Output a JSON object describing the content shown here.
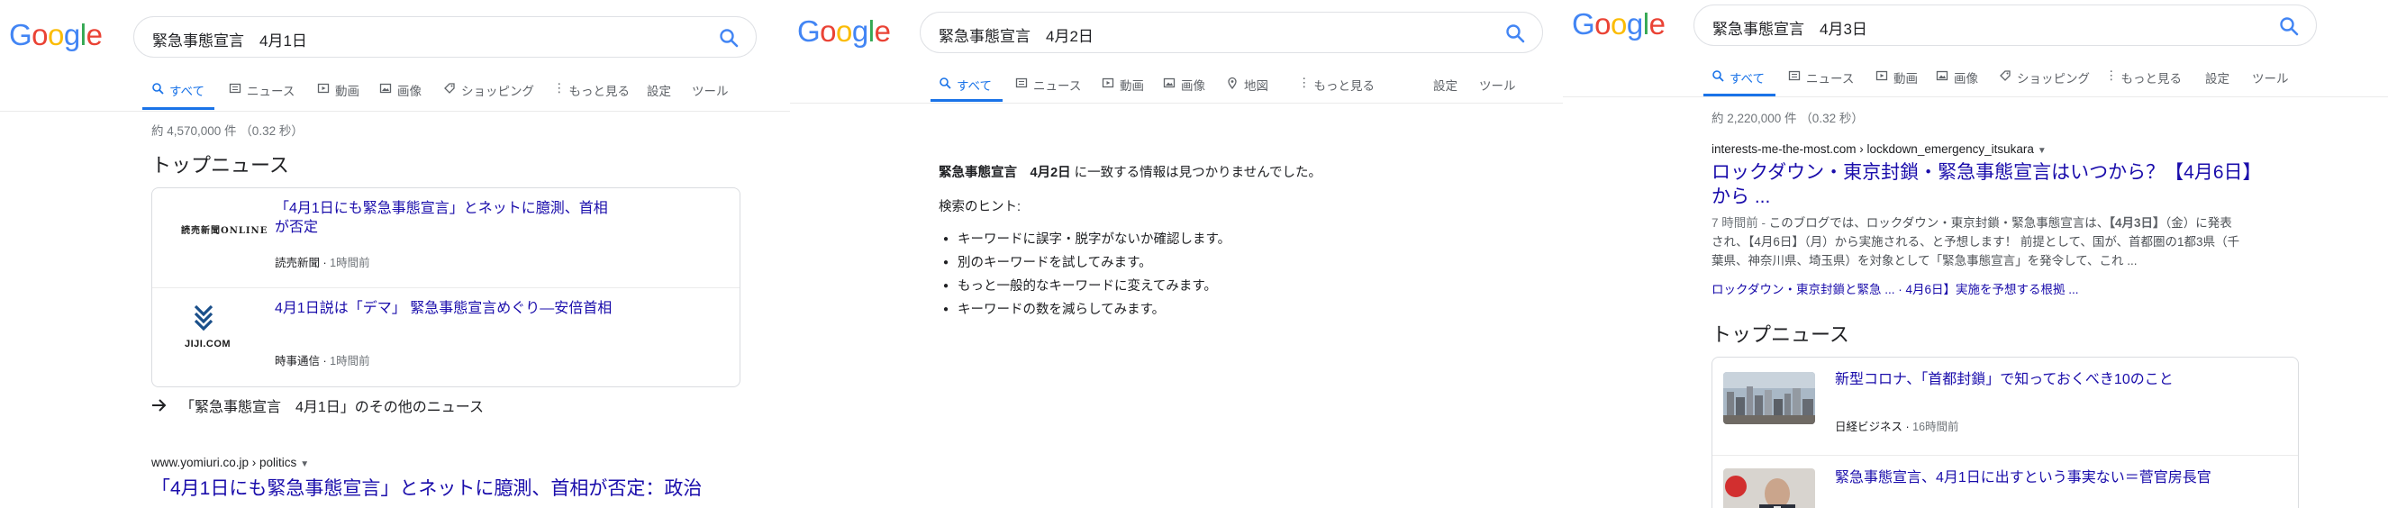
{
  "logo": {
    "g1": "G",
    "o1": "o",
    "o2": "o",
    "g2": "g",
    "l": "l",
    "e": "e"
  },
  "panel1": {
    "query": "緊急事態宣言　4月1日",
    "tabs": [
      "すべて",
      "ニュース",
      "動画",
      "画像",
      "ショッピング",
      "もっと見る",
      "設定",
      "ツール"
    ],
    "stats": "約 4,570,000 件 （0.32 秒）",
    "top_news_heading": "トップニュース",
    "news": [
      {
        "source_logo_text": "読売新聞ONLINE",
        "title": "「4月1日にも緊急事態宣言」とネットに臆測、首相が否定",
        "source": "読売新聞",
        "ago": "1時間前"
      },
      {
        "source_logo_text": "JIJI.COM",
        "title": "4月1日説は「デマ」 緊急事態宣言めぐり―安倍首相",
        "source": "時事通信",
        "ago": "1時間前"
      }
    ],
    "more_news": "「緊急事態宣言　4月1日」のその他のニュース",
    "result": {
      "url": "www.yomiuri.co.jp › politics",
      "title": "「4月1日にも緊急事態宣言」とネットに臆測、首相が否定：政治"
    }
  },
  "panel2": {
    "query": "緊急事態宣言　4月2日",
    "tabs": [
      "すべて",
      "ニュース",
      "動画",
      "画像",
      "地図",
      "もっと見る",
      "設定",
      "ツール"
    ],
    "no_result_query": "緊急事態宣言　4月2日",
    "no_result_suffix": " に一致する情報は見つかりませんでした。",
    "hints_title": "検索のヒント:",
    "hints": [
      "キーワードに誤字・脱字がないか確認します。",
      "別のキーワードを試してみます。",
      "もっと一般的なキーワードに変えてみます。",
      "キーワードの数を減らしてみます。"
    ]
  },
  "panel3": {
    "query": "緊急事態宣言　4月3日",
    "tabs": [
      "すべて",
      "ニュース",
      "動画",
      "画像",
      "ショッピング",
      "もっと見る",
      "設定",
      "ツール"
    ],
    "stats": "約 2,220,000 件 （0.32 秒）",
    "result": {
      "url": "interests-me-the-most.com › lockdown_emergency_itsukara",
      "title_line1": "ロックダウン・東京封鎖・緊急事態宣言はいつから？【4月6日】",
      "title_line2": "から ...",
      "snippet_date": "7 時間前 - ",
      "snippet_a": "このブログでは、ロックダウン・東京封鎖・緊急事態宣言は、",
      "snippet_bold1": "【4月3日】",
      "snippet_b": "（金）に発表され、【4月6日】（月）から実施される、と予想します！ 前提として、国が、首都圏の1都3県（千葉県、神奈川県、埼玉県）を対象として「緊急事態宣言」を発令して、これ ...",
      "sitelinks": "ロックダウン・東京封鎖と緊急 ... · 4月6日】実施を予想する根拠 ..."
    },
    "top_news_heading": "トップニュース",
    "news": [
      {
        "title": "新型コロナ、「首都封鎖」で知っておくべき10のこと",
        "source": "日経ビジネス",
        "ago": "16時間前"
      },
      {
        "title": "緊急事態宣言、4月1日に出すという事実ない＝菅官房長官",
        "source": "",
        "ago": ""
      }
    ]
  }
}
